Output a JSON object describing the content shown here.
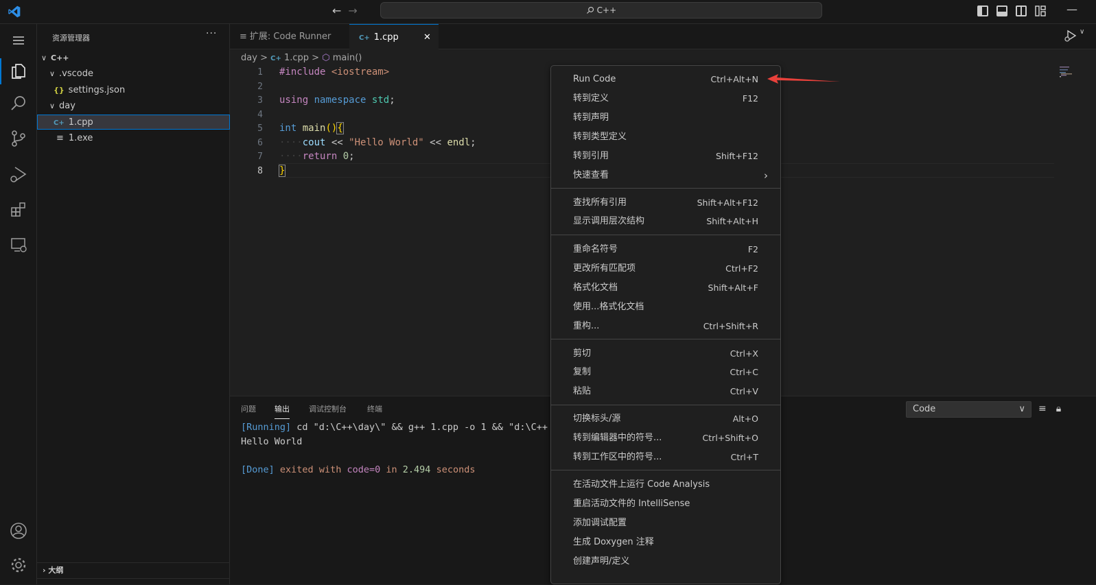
{
  "titlebar": {
    "search_text": "C++",
    "nav_back": "←",
    "nav_forward": "→",
    "minimize": "—"
  },
  "sidebar": {
    "title": "资源管理器",
    "more": "···",
    "tree": [
      {
        "label": "C++",
        "twisty": "∨",
        "depth": 0,
        "kind": "folder"
      },
      {
        "label": ".vscode",
        "twisty": "∨",
        "depth": 1,
        "kind": "folder"
      },
      {
        "label": "settings.json",
        "icon": "{}",
        "depth": 2,
        "kind": "json"
      },
      {
        "label": "day",
        "twisty": "∨",
        "depth": 1,
        "kind": "folder"
      },
      {
        "label": "1.cpp",
        "icon": "C+",
        "depth": 2,
        "kind": "cpp",
        "selected": true
      },
      {
        "label": "1.exe",
        "icon": "≡",
        "depth": 2,
        "kind": "exe"
      }
    ],
    "outline_label": "大纲"
  },
  "tabs": [
    {
      "label": "扩展: Code Runner",
      "icon": "≡",
      "active": false
    },
    {
      "label": "1.cpp",
      "icon": "C+",
      "active": true,
      "close": "✕"
    }
  ],
  "breadcrumb": {
    "folder": "day",
    "file": "1.cpp",
    "symbol": "main()",
    "sep": ">"
  },
  "editor": {
    "line_numbers": [
      "1",
      "2",
      "3",
      "4",
      "5",
      "6",
      "7",
      "8"
    ],
    "current_line": "8"
  },
  "panel": {
    "tabs": [
      "问题",
      "输出",
      "调试控制台",
      "终端"
    ],
    "active_tab": "输出",
    "select_value": "Code",
    "output": {
      "running_tag": "[Running]",
      "running_cmd": "cd \"d:\\C++\\day\\\" && g++ 1.cpp -o 1 && \"d:\\C++",
      "hello": "Hello World",
      "done_tag": "[Done]",
      "done_pre": "exited with",
      "done_code": "code=0",
      "done_mid": "in",
      "done_time": "2.494",
      "done_post": "seconds"
    }
  },
  "context_menu": [
    {
      "label": "Run Code",
      "key": "Ctrl+Alt+N"
    },
    {
      "label": "转到定义",
      "key": "F12"
    },
    {
      "label": "转到声明",
      "key": ""
    },
    {
      "label": "转到类型定义",
      "key": ""
    },
    {
      "label": "转到引用",
      "key": "Shift+F12"
    },
    {
      "label": "快速查看",
      "key": "›"
    },
    {
      "label": "查找所有引用",
      "key": "Shift+Alt+F12"
    },
    {
      "label": "显示调用层次结构",
      "key": "Shift+Alt+H"
    },
    {
      "label": "重命名符号",
      "key": "F2"
    },
    {
      "label": "更改所有匹配项",
      "key": "Ctrl+F2"
    },
    {
      "label": "格式化文档",
      "key": "Shift+Alt+F"
    },
    {
      "label": "使用...格式化文档",
      "key": ""
    },
    {
      "label": "重构...",
      "key": "Ctrl+Shift+R"
    },
    {
      "label": "剪切",
      "key": "Ctrl+X"
    },
    {
      "label": "复制",
      "key": "Ctrl+C"
    },
    {
      "label": "粘贴",
      "key": "Ctrl+V"
    },
    {
      "label": "切换标头/源",
      "key": "Alt+O"
    },
    {
      "label": "转到编辑器中的符号...",
      "key": "Ctrl+Shift+O"
    },
    {
      "label": "转到工作区中的符号...",
      "key": "Ctrl+T"
    },
    {
      "label": "在活动文件上运行 Code Analysis",
      "key": ""
    },
    {
      "label": "重启活动文件的 IntelliSense",
      "key": ""
    },
    {
      "label": "添加调试配置",
      "key": ""
    },
    {
      "label": "生成 Doxygen 注释",
      "key": ""
    },
    {
      "label": "创建声明/定义",
      "key": ""
    }
  ],
  "colors": {
    "accent": "#0078d4",
    "arrow": "#e8413b",
    "vscode_logo": "#2d8ee6"
  }
}
